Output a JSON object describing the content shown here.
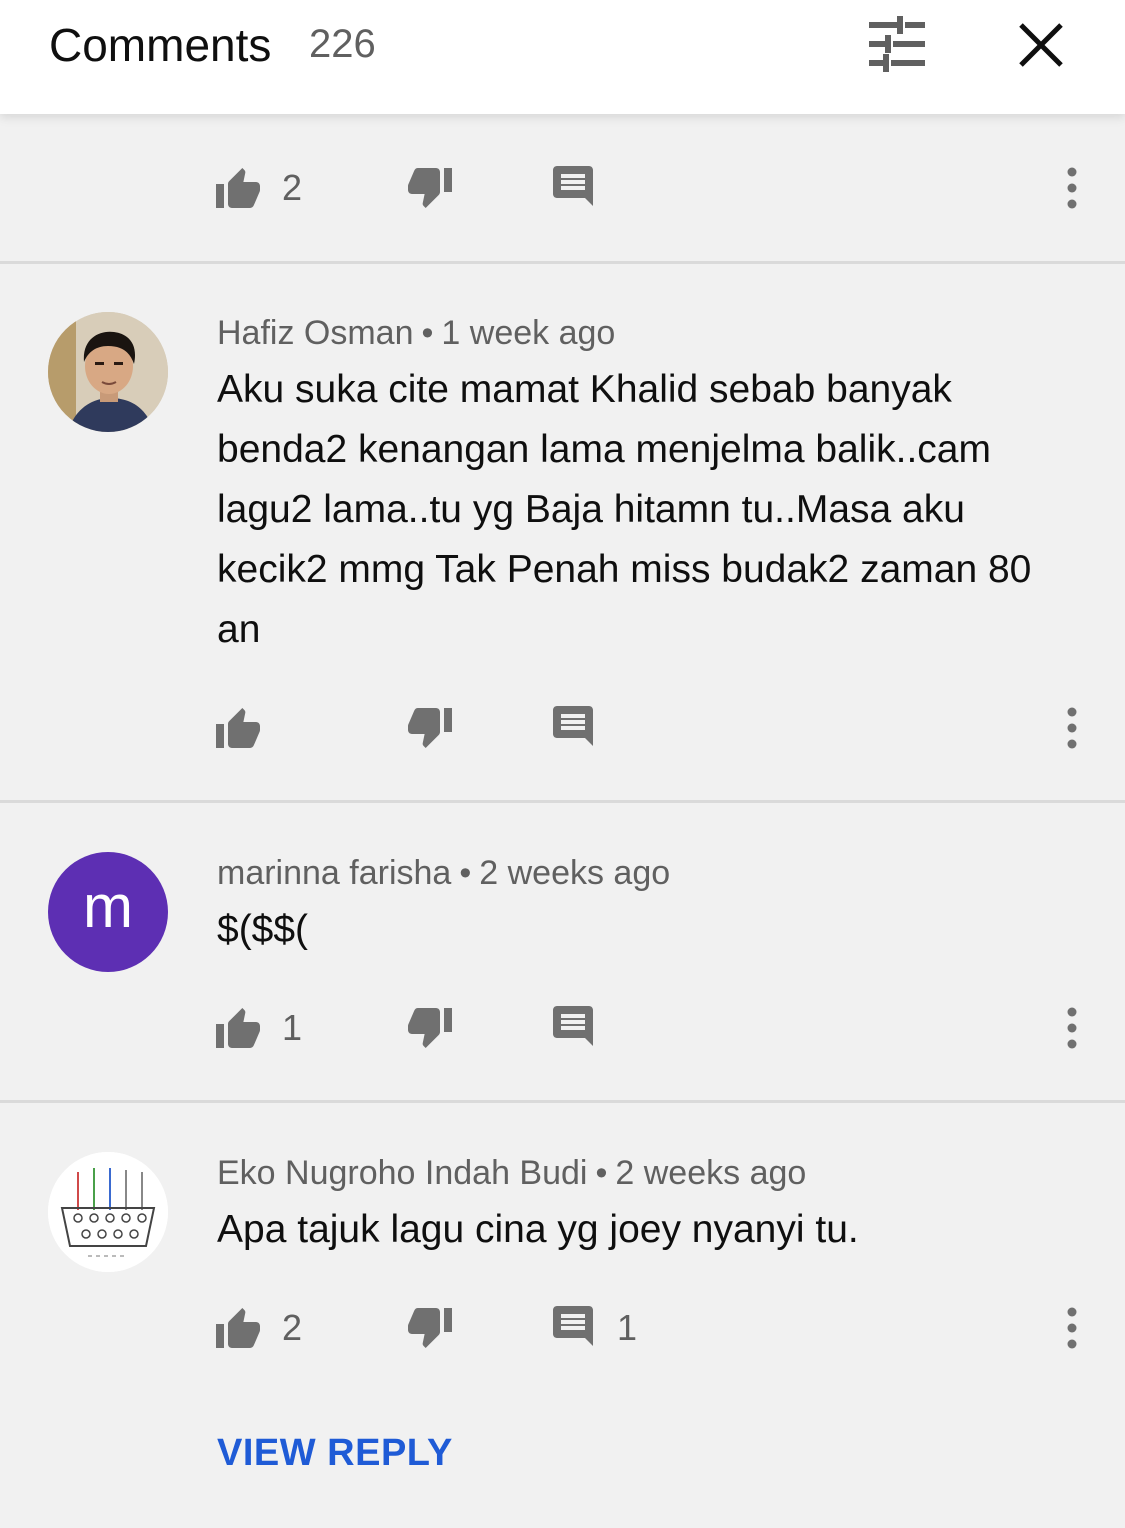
{
  "header": {
    "title": "Comments",
    "count": "226",
    "filter_icon": "sort-filter-icon",
    "close_icon": "close-icon"
  },
  "top_actions": {
    "likes": "2"
  },
  "comments": [
    {
      "author": "Hafiz Osman",
      "separator": "•",
      "time": "1 week ago",
      "text": "Aku suka cite mamat Khalid sebab  banyak benda2 kenangan lama menjelma balik..cam lagu2 lama..tu yg Baja hitamn tu..Masa aku kecik2 mmg Tak Penah miss budak2 zaman 80 an",
      "likes": "",
      "replies": ""
    },
    {
      "author": "marinna farisha",
      "separator": "•",
      "time": "2 weeks ago",
      "avatar_letter": "m",
      "avatar_color": "#5d2fb3",
      "text": "$($$(",
      "likes": "1",
      "replies": ""
    },
    {
      "author": "Eko Nugroho Indah Budi",
      "separator": "•",
      "time": "2 weeks ago",
      "text": "Apa tajuk lagu cina yg joey nyanyi tu.",
      "likes": "2",
      "replies": "1"
    }
  ],
  "view_reply": "VIEW REPLY",
  "colors": {
    "link": "#1f5bd6",
    "icon": "#707070",
    "background": "#f1f1f1"
  }
}
